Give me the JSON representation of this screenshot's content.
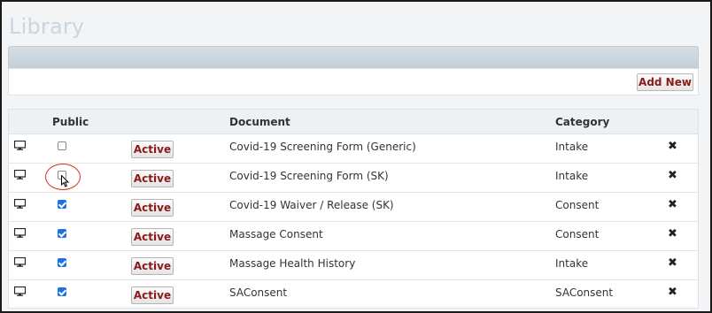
{
  "page": {
    "title": "Library"
  },
  "toolbar": {
    "add_new_label": "Add New"
  },
  "table": {
    "headers": {
      "public": "Public",
      "document": "Document",
      "category": "Category"
    },
    "rows": [
      {
        "public": false,
        "status": "Active",
        "document": "Covid-19 Screening Form (Generic)",
        "category": "Intake"
      },
      {
        "public": false,
        "status": "Active",
        "document": "Covid-19 Screening Form (SK)",
        "category": "Intake"
      },
      {
        "public": true,
        "status": "Active",
        "document": "Covid-19 Waiver / Release (SK)",
        "category": "Consent"
      },
      {
        "public": true,
        "status": "Active",
        "document": "Massage Consent",
        "category": "Consent"
      },
      {
        "public": true,
        "status": "Active",
        "document": "Massage Health History",
        "category": "Intake"
      },
      {
        "public": true,
        "status": "Active",
        "document": "SAConsent",
        "category": "SAConsent"
      }
    ]
  },
  "icons": {
    "row_view": "desktop-icon",
    "row_delete": "close-icon",
    "annotation": "red-circle-highlight",
    "pointer": "mouse-cursor-icon"
  },
  "colors": {
    "title": "#c9d6e0",
    "button_text": "#8b1a1a",
    "checkbox_checked": "#1a73e8",
    "highlight": "#d93025"
  }
}
